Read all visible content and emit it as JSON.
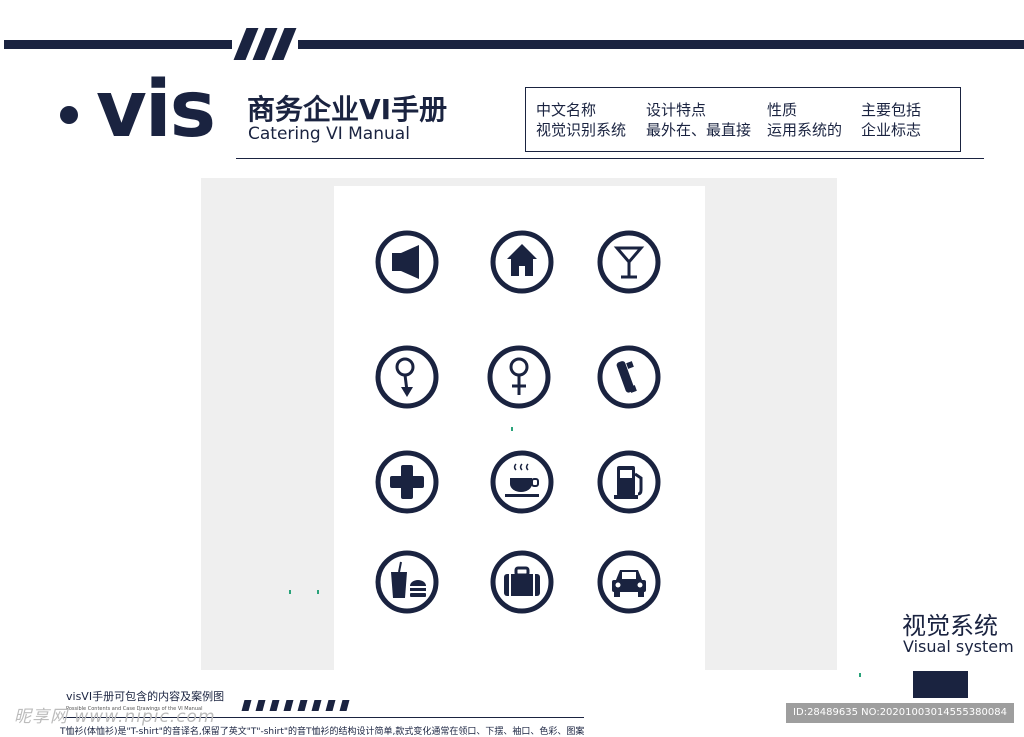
{
  "header": {
    "brand": "vis",
    "title_cn": "商务企业VI手册",
    "title_en": "Catering VI Manual"
  },
  "info_box": {
    "columns": [
      {
        "line1": "中文名称",
        "line2": "视觉识别系统"
      },
      {
        "line1": "设计特点",
        "line2": "最外在、最直接"
      },
      {
        "line1": "性质",
        "line2": "运用系统的"
      },
      {
        "line1": "主要包括",
        "line2": "企业标志"
      }
    ]
  },
  "icons": [
    "speaker-icon",
    "home-icon",
    "cocktail-icon",
    "male-symbol-icon",
    "female-symbol-icon",
    "phone-icon",
    "medical-cross-icon",
    "coffee-cup-icon",
    "gas-station-icon",
    "fast-food-icon",
    "suitcase-icon",
    "car-icon"
  ],
  "side": {
    "title_cn": "视觉系统",
    "title_en": "Visual system"
  },
  "caption": {
    "title": "visVI手册可包含的内容及案例图",
    "subtitle": "Possible Contents and Case Drawings of the VI Manual",
    "body": "T恤衫(体恤衫)是\"T-shirt\"的音译名,保留了英文\"T\"-shirt\"的音T恤衫的结构设计简单,款式变化通常在领口、下摆、袖口、色彩、图案"
  },
  "watermark": {
    "left": "昵享网 www.nipic.com",
    "right": "ID:28489635 NO:20201003014555380084"
  },
  "colors": {
    "navy": "#1a2340",
    "panel": "#efefef"
  }
}
